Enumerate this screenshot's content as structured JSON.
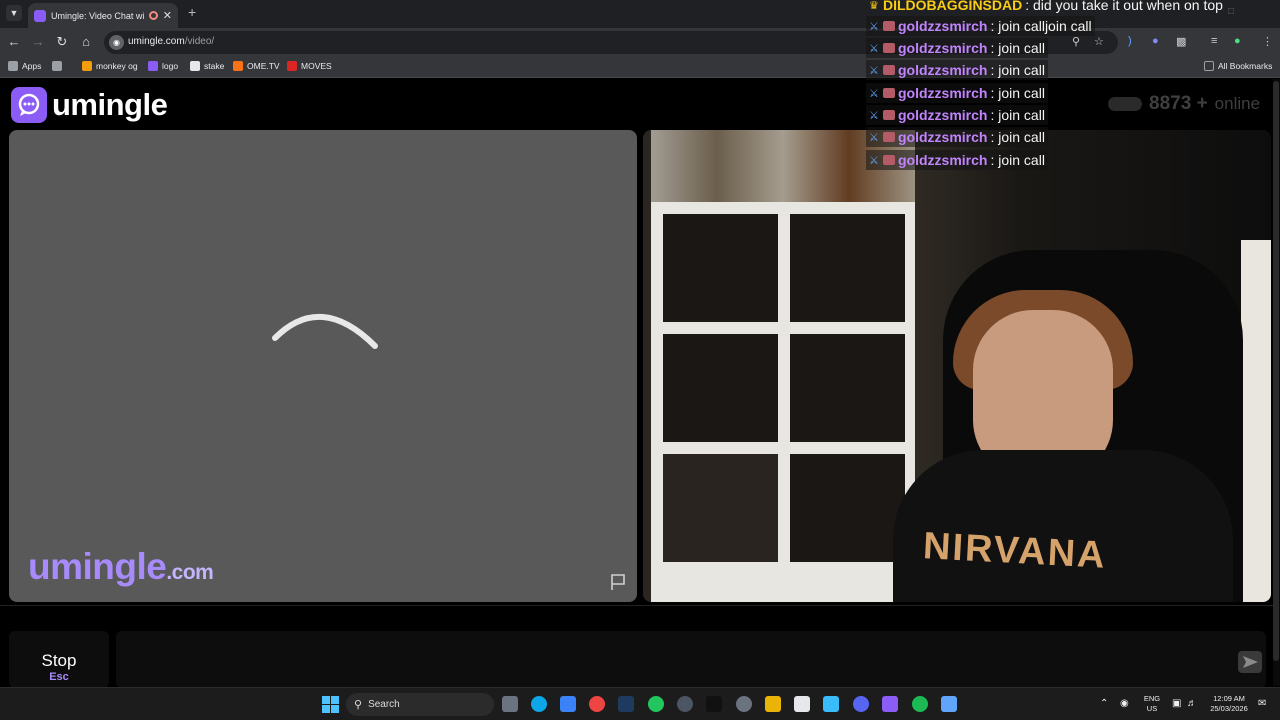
{
  "browser": {
    "tab_title": "Umingle: Video Chat with S",
    "new_tab": "+",
    "url_domain": "umingle.com",
    "url_path": "/video/",
    "bookmarks": [
      {
        "label": "Apps",
        "icon": "apps-grid-icon",
        "color": "#9aa0a6"
      },
      {
        "label": "",
        "icon": "grid-icon",
        "color": "#9aa0a6"
      },
      {
        "label": "monkey og",
        "icon": "monkey-icon",
        "color": "#f59e0b"
      },
      {
        "label": "logo",
        "icon": "logo-icon",
        "color": "#8b5cf6"
      },
      {
        "label": "stake",
        "icon": "stake-icon",
        "color": "#e5e7eb"
      },
      {
        "label": "OME.TV",
        "icon": "ometv-icon",
        "color": "#f97316"
      },
      {
        "label": "MOVES",
        "icon": "moves-icon",
        "color": "#dc2626"
      }
    ],
    "all_bookmarks": "All Bookmarks"
  },
  "site": {
    "logo_text": "umingle",
    "online_count": "8873",
    "online_plus": "+",
    "online_label": "online",
    "watermark_main": "umingle",
    "watermark_domain": ".com",
    "accent": "#8b5cf6"
  },
  "video_right": {
    "shirt_text": "NIRVANA"
  },
  "controls": {
    "stop_label": "Stop",
    "stop_key": "Esc"
  },
  "chat": [
    {
      "user": "DILDOBAGGINSDAD",
      "msg": ": did you take it out when on top",
      "badge": "gold"
    },
    {
      "user": "goldzzsmirch",
      "msg": ": join calljoin call",
      "badge": "sword"
    },
    {
      "user": "goldzzsmirch",
      "msg": ": join call",
      "badge": "sword"
    },
    {
      "user": "goldzzsmirch",
      "msg": ": join call",
      "badge": "sword"
    },
    {
      "user": "goldzzsmirch",
      "msg": ": join call",
      "badge": "sword"
    },
    {
      "user": "goldzzsmirch",
      "msg": ": join call",
      "badge": "sword"
    },
    {
      "user": "goldzzsmirch",
      "msg": ": join call",
      "badge": "sword"
    },
    {
      "user": "goldzzsmirch",
      "msg": ": join call",
      "badge": "sword"
    }
  ],
  "taskbar": {
    "search_placeholder": "Search",
    "lang": "ENG",
    "region": "US",
    "time": "12:09 AM",
    "date": "25/03/2026"
  }
}
